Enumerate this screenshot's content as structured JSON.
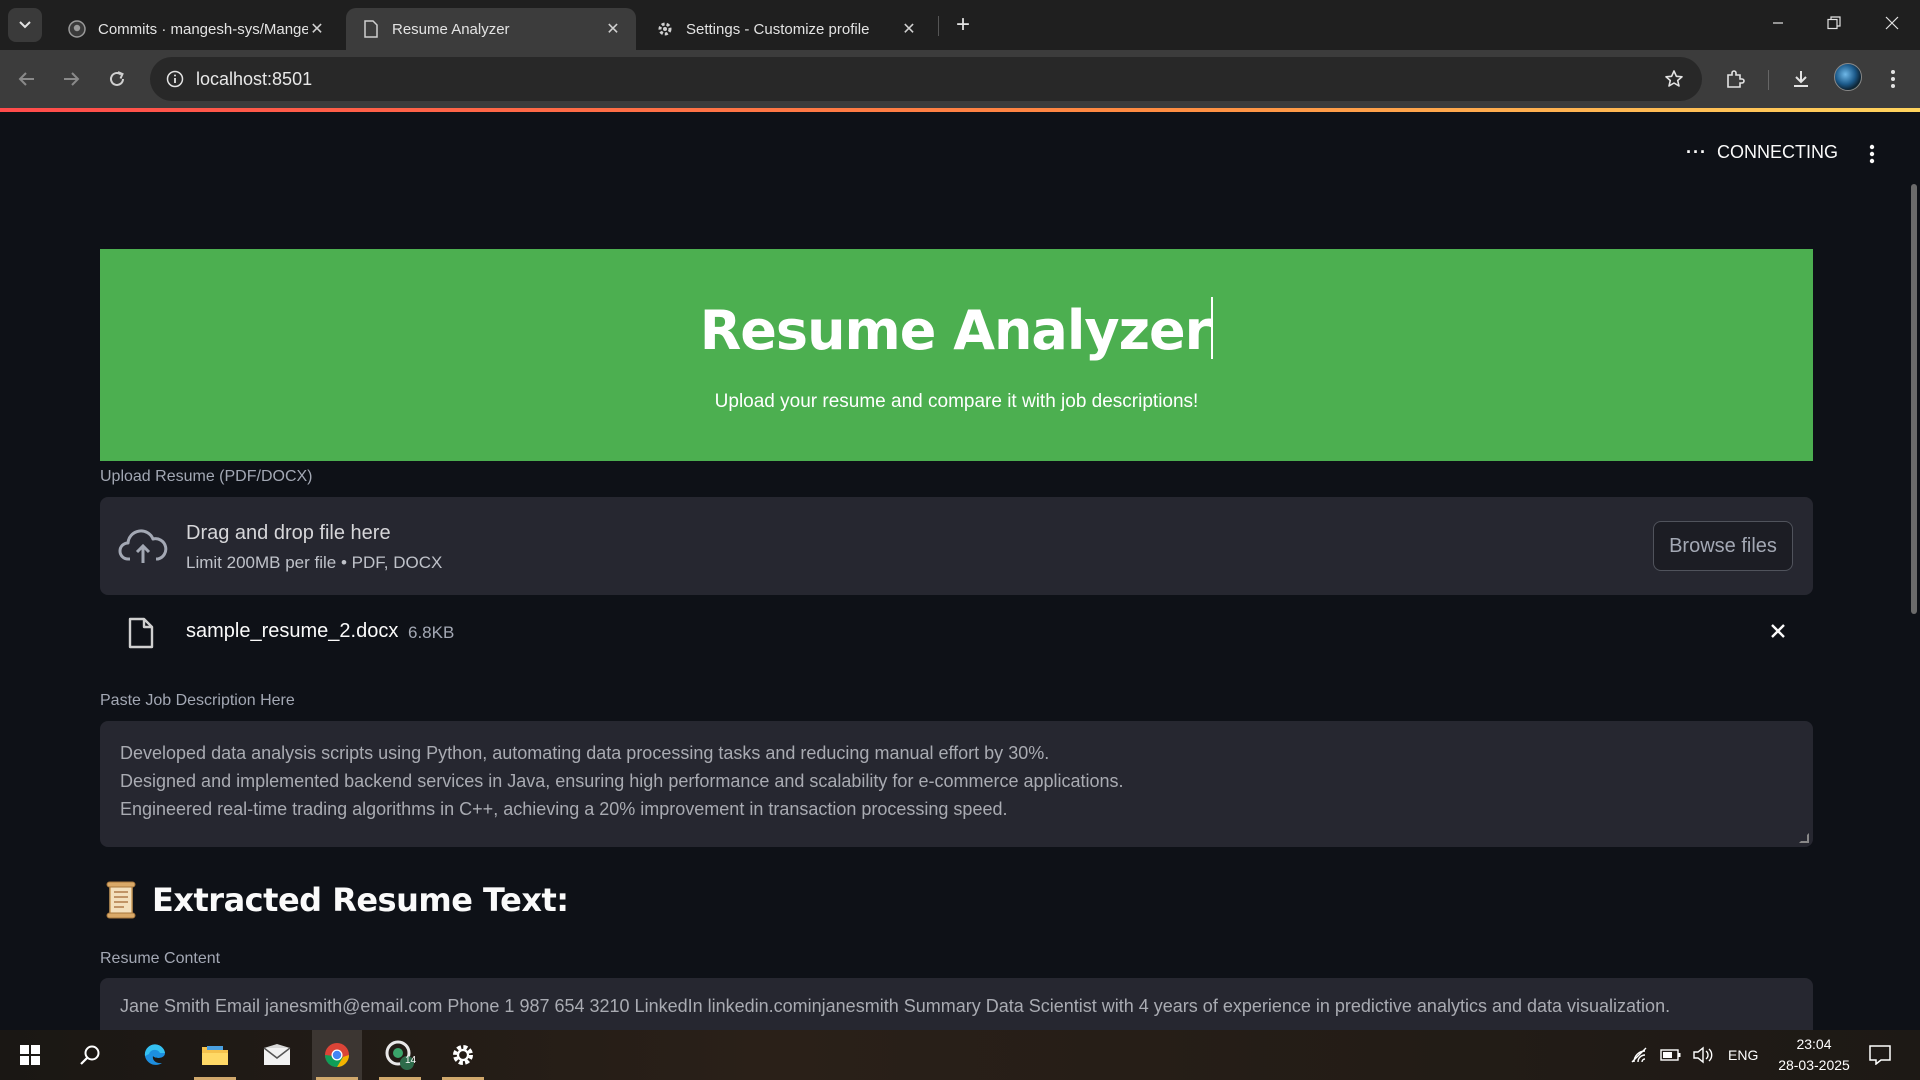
{
  "browser": {
    "tabs": [
      {
        "title": "Commits · mangesh-sys/Mange",
        "icon": "github-icon",
        "active": false
      },
      {
        "title": "Resume Analyzer",
        "icon": "page-icon",
        "active": true
      },
      {
        "title": "Settings - Customize profile",
        "icon": "gear-icon",
        "active": false
      }
    ],
    "url": "localhost:8501"
  },
  "app": {
    "status": "CONNECTING",
    "hero": {
      "title": "Resume Analyzer",
      "subtitle": "Upload your resume and compare it with job descriptions!",
      "background": "#4caf50"
    },
    "uploader": {
      "label": "Upload Resume (PDF/DOCX)",
      "drag_text": "Drag and drop file here",
      "limit_text": "Limit 200MB per file • PDF, DOCX",
      "browse_label": "Browse files",
      "file_name": "sample_resume_2.docx",
      "file_size": "6.8KB"
    },
    "job_description": {
      "label": "Paste Job Description Here",
      "lines": [
        "Developed data analysis scripts using Python, automating data processing tasks and reducing manual effort by 30%.",
        "Designed and implemented backend services in Java, ensuring high performance and scalability for e-commerce applications.",
        "Engineered real-time trading algorithms in C++, achieving a 20% improvement in transaction processing speed."
      ]
    },
    "extracted": {
      "heading": "Extracted Resume Text:",
      "content_label": "Resume Content",
      "content": "Jane Smith Email janesmith@email.com Phone 1 987 654 3210 LinkedIn linkedin.cominjanesmith Summary Data Scientist with 4 years of experience in predictive analytics and data visualization."
    }
  },
  "taskbar": {
    "language": "ENG",
    "time": "23:04",
    "date": "28-03-2025",
    "badge_count": "14"
  }
}
